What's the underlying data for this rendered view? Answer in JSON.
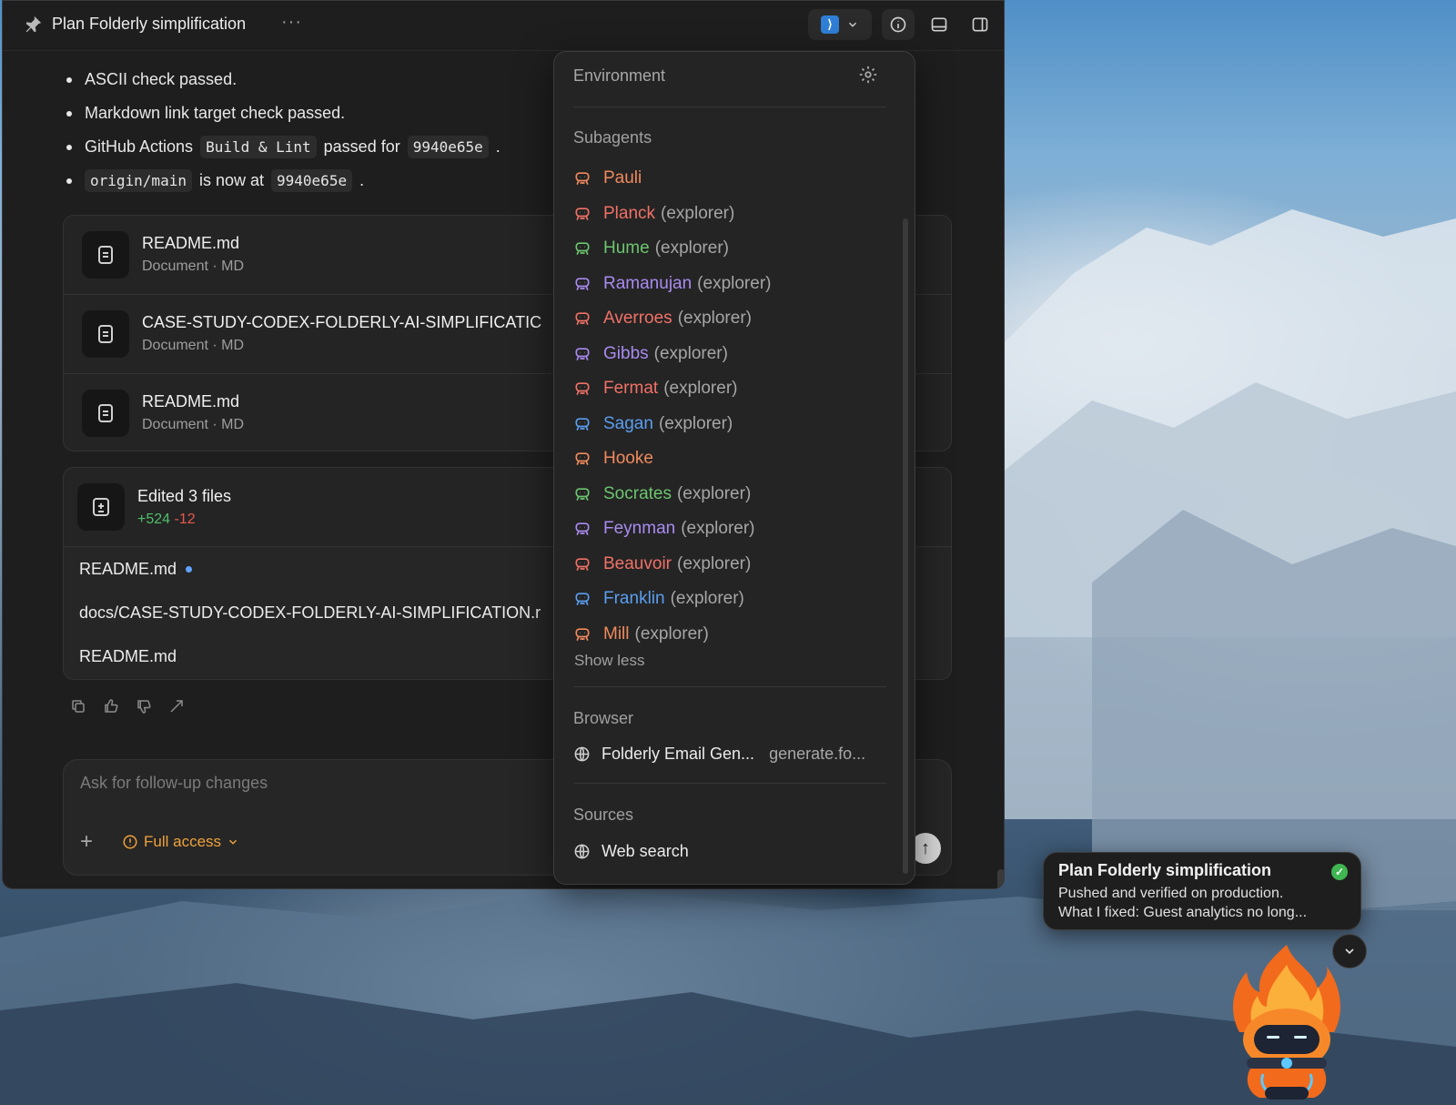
{
  "window": {
    "title": "Plan Folderly simplification"
  },
  "colors": {
    "accent_orange": "#f0a23b",
    "added_green": "#4fbf6a",
    "deleted_red": "#e8584e",
    "modified_blue": "#5fa3ff"
  },
  "message": {
    "bullets": [
      {
        "text": "ASCII check passed."
      },
      {
        "text": "Markdown link target check passed."
      },
      {
        "pre": "GitHub Actions",
        "code1": "Build & Lint",
        "mid": "passed for",
        "code2": "9940e65e",
        "post": "."
      },
      {
        "code1": "origin/main",
        "mid": "is now at",
        "code2": "9940e65e",
        "post": "."
      }
    ]
  },
  "files": [
    {
      "name": "README.md",
      "meta": "Document · MD"
    },
    {
      "name": "CASE-STUDY-CODEX-FOLDERLY-AI-SIMPLIFICATIC",
      "meta": "Document · MD"
    },
    {
      "name": "README.md",
      "meta": "Document · MD"
    }
  ],
  "edits": {
    "title": "Edited 3 files",
    "added": "+524",
    "removed": "-12",
    "files": [
      {
        "path": "README.md"
      },
      {
        "path": "docs/CASE-STUDY-CODEX-FOLDERLY-AI-SIMPLIFICATION.r"
      },
      {
        "path": "README.md"
      }
    ]
  },
  "composer": {
    "placeholder": "Ask for follow-up changes",
    "access_label": "Full access"
  },
  "dropdown": {
    "environment_label": "Environment",
    "subagents_label": "Subagents",
    "subagents": [
      {
        "name": "Pauli",
        "role": "",
        "color": "#f08a5d"
      },
      {
        "name": "Planck",
        "role": "(explorer)",
        "color": "#f07167"
      },
      {
        "name": "Hume",
        "role": "(explorer)",
        "color": "#6cc56f"
      },
      {
        "name": "Ramanujan",
        "role": "(explorer)",
        "color": "#a98bf0"
      },
      {
        "name": "Averroes",
        "role": "(explorer)",
        "color": "#f07167"
      },
      {
        "name": "Gibbs",
        "role": "(explorer)",
        "color": "#a98bf0"
      },
      {
        "name": "Fermat",
        "role": "(explorer)",
        "color": "#f07167"
      },
      {
        "name": "Sagan",
        "role": "(explorer)",
        "color": "#5b9ef0"
      },
      {
        "name": "Hooke",
        "role": "",
        "color": "#f08a5d"
      },
      {
        "name": "Socrates",
        "role": "(explorer)",
        "color": "#6cc56f"
      },
      {
        "name": "Feynman",
        "role": "(explorer)",
        "color": "#a98bf0"
      },
      {
        "name": "Beauvoir",
        "role": "(explorer)",
        "color": "#f07167"
      },
      {
        "name": "Franklin",
        "role": "(explorer)",
        "color": "#5b9ef0"
      },
      {
        "name": "Mill",
        "role": "(explorer)",
        "color": "#f08a5d"
      }
    ],
    "show_less": "Show less",
    "browser_label": "Browser",
    "browser_item": {
      "title": "Folderly Email Gen...",
      "url": "generate.fo..."
    },
    "sources_label": "Sources",
    "sources_item": "Web search"
  },
  "toast": {
    "title": "Plan Folderly simplification",
    "line1": "Pushed and verified on production.",
    "line2": "What I fixed: Guest analytics no long..."
  }
}
